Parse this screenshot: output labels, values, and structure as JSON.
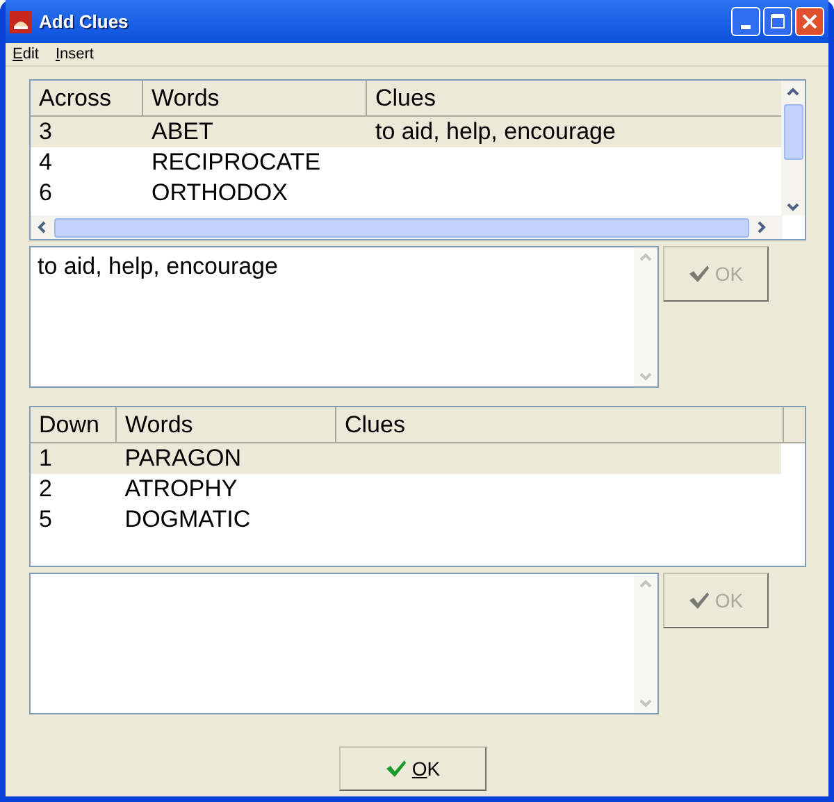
{
  "window": {
    "title": "Add Clues"
  },
  "menu": [
    {
      "label": "Edit"
    },
    {
      "label": "Insert"
    }
  ],
  "across": {
    "columns": [
      "Across",
      "Words",
      "Clues"
    ],
    "rows": [
      {
        "cells": [
          "3",
          "ABET",
          "to aid, help, encourage"
        ],
        "selected": true
      },
      {
        "cells": [
          "4",
          "RECIPROCATE"
        ],
        "selected": false
      },
      {
        "cells": [
          "6",
          "ORTHODOX"
        ],
        "selected": false
      }
    ]
  },
  "across_clue": {
    "value": "to aid, help, encourage"
  },
  "across_ok": {
    "label": "OK",
    "disabled": true
  },
  "down": {
    "columns": [
      "Down",
      "Words",
      "Clues"
    ],
    "rows": [
      {
        "cells": [
          "1",
          "PARAGON"
        ],
        "selected": true
      },
      {
        "cells": [
          "2",
          "ATROPHY"
        ],
        "selected": false
      },
      {
        "cells": [
          "5",
          "DOGMATIC"
        ],
        "selected": false
      }
    ]
  },
  "down_ok": {
    "label": "OK",
    "disabled": true
  },
  "ok_button": {
    "label": "OK",
    "disabled": false
  }
}
